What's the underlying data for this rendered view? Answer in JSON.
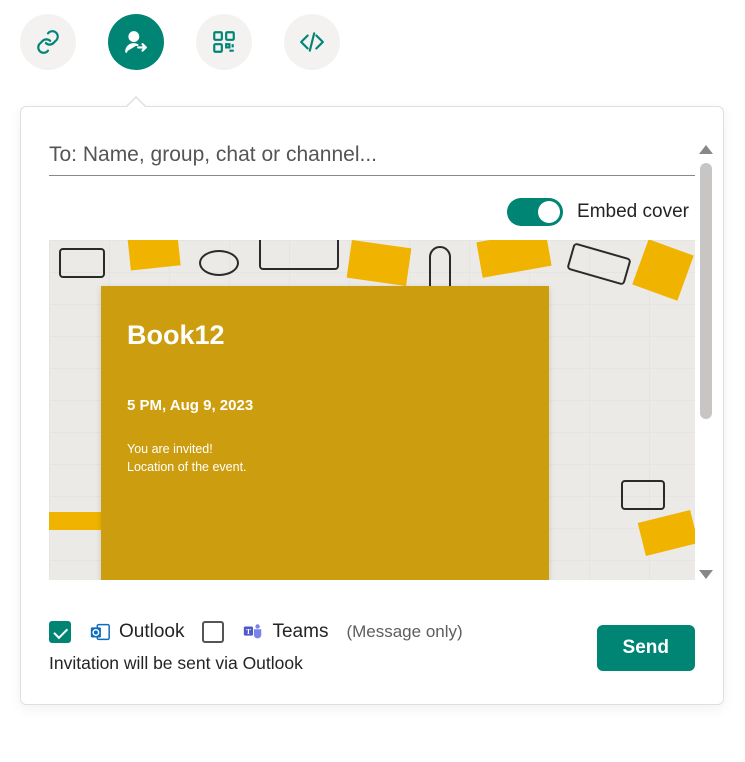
{
  "iconRow": {
    "link": "link-icon",
    "invite": "person-arrow-icon",
    "qr": "qr-icon",
    "embed": "code-icon",
    "active": "invite"
  },
  "to": {
    "placeholder": "To: Name, group, chat or channel..."
  },
  "embed": {
    "label": "Embed cover",
    "on": true
  },
  "cover": {
    "title": "Book12",
    "time": "5 PM, Aug 9, 2023",
    "line1": "You are invited!",
    "line2": "Location of the event."
  },
  "footer": {
    "outlook": {
      "label": "Outlook",
      "checked": true
    },
    "teams": {
      "label": "Teams",
      "checked": false
    },
    "messageOnly": "(Message only)",
    "note": "Invitation will be sent via Outlook",
    "send": "Send"
  }
}
